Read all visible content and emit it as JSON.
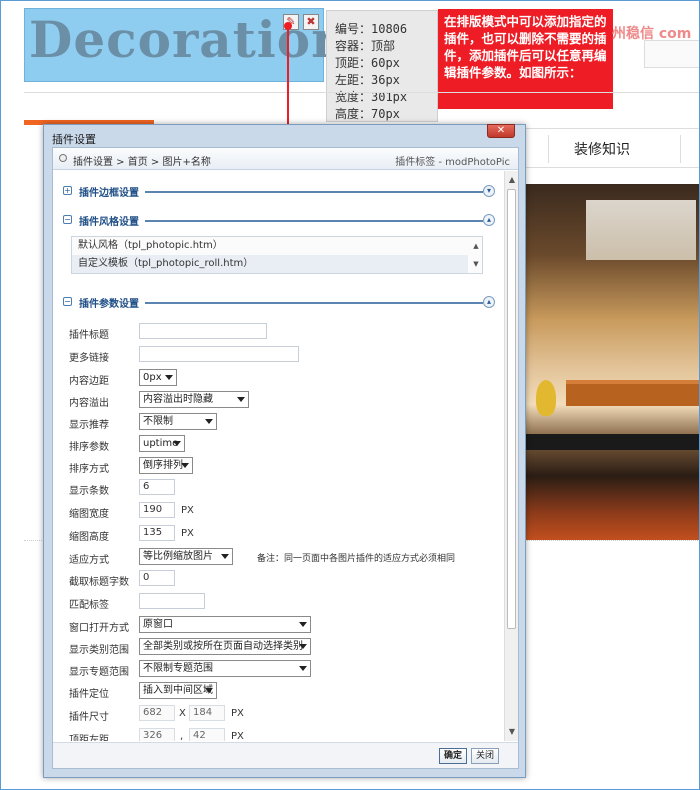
{
  "header": {
    "deco_text": "Decoration",
    "info": [
      "编号：10806",
      "容器：顶部",
      "顶距：60px",
      "左距：36px",
      "宽度：301px",
      "高度：70px"
    ],
    "note": "在排版模式中可以添加指定的插件，也可以删除不需要的插件，添加插件后可以任意再编辑插件参数。如图所示：",
    "watermark": "州稳信 com",
    "nav_item": "装修知识"
  },
  "dialog": {
    "title": "插件设置",
    "breadcrumb": "插件设置 > 首页 > 图片+名称",
    "plugin_tag": "插件标签 - modPhotoPic",
    "sections": {
      "border": "插件边框设置",
      "style": "插件风格设置",
      "params": "插件参数设置"
    },
    "style_list": [
      "默认风格（tpl_photopic.htm）",
      "自定义模板（tpl_photopic_roll.htm）"
    ],
    "fields": {
      "title_label": "插件标题",
      "more_label": "更多链接",
      "padding_label": "内容边距",
      "padding_value": "0px",
      "overflow_label": "内容溢出",
      "overflow_value": "内容溢出时隐藏",
      "recommend_label": "显示推荐",
      "recommend_value": "不限制",
      "sort_param_label": "排序参数",
      "sort_param_value": "uptime",
      "sort_order_label": "排序方式",
      "sort_order_value": "倒序排列",
      "count_label": "显示条数",
      "count_value": "6",
      "thumb_w_label": "缩图宽度",
      "thumb_w_value": "190",
      "thumb_h_label": "缩图高度",
      "thumb_h_value": "135",
      "fit_label": "适应方式",
      "fit_value": "等比例缩放图片",
      "fit_note": "备注：同一页面中各图片插件的适应方式必须相同",
      "trunc_label": "截取标题字数",
      "trunc_value": "0",
      "match_label": "匹配标签",
      "window_label": "窗口打开方式",
      "window_value": "原窗口",
      "category_label": "显示类别范围",
      "category_value": "全部类别或按所在页面自动选择类别",
      "topic_label": "显示专题范围",
      "topic_value": "不限制专题范围",
      "position_label": "插件定位",
      "position_value": "插入到中间区域",
      "size_label": "插件尺寸",
      "size_w": "682",
      "size_h": "184",
      "offset_label": "顶距左距",
      "offset_top": "326",
      "offset_left": "42",
      "unit_px": "PX",
      "x_sep": "X",
      "comma_sep": ","
    },
    "buttons": {
      "ok": "确定",
      "close": "关闭"
    }
  },
  "colors": {
    "note_bg": "#ee1c25",
    "deco_bg": "#8fcdf0",
    "section_blue": "#1f4f86",
    "accent_orange": "#f16522"
  }
}
